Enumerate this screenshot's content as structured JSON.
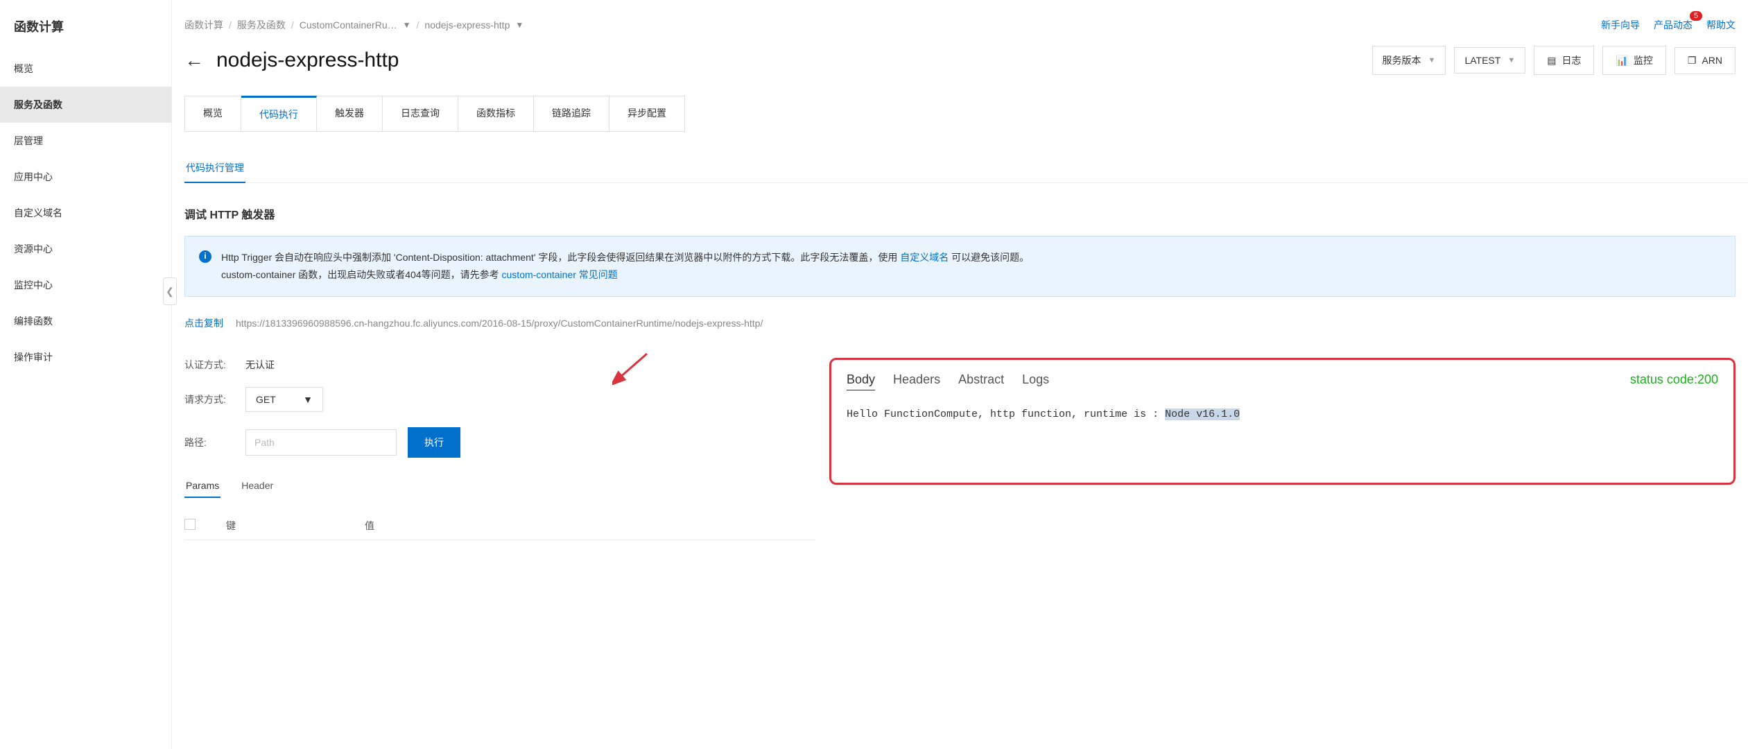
{
  "sidebar": {
    "title": "函数计算",
    "items": [
      "概览",
      "服务及函数",
      "层管理",
      "应用中心",
      "自定义域名",
      "资源中心",
      "监控中心",
      "编排函数",
      "操作审计"
    ],
    "active_index": 1
  },
  "top_links": {
    "guide": "新手向导",
    "news": "产品动态",
    "news_badge": "5",
    "help": "帮助文"
  },
  "breadcrumb": {
    "a": "函数计算",
    "b": "服务及函数",
    "c": "CustomContainerRu…",
    "d": "nodejs-express-http"
  },
  "page_title": "nodejs-express-http",
  "header_actions": {
    "version_label": "服务版本",
    "latest_label": "LATEST",
    "log_label": "日志",
    "monitor_label": "监控",
    "arn_label": "ARN"
  },
  "tabs": [
    "概览",
    "代码执行",
    "触发器",
    "日志查询",
    "函数指标",
    "链路追踪",
    "异步配置"
  ],
  "active_tab_index": 1,
  "subtab": "代码执行管理",
  "section_title": "调试 HTTP 触发器",
  "info": {
    "line1_a": "Http Trigger 会自动在响应头中强制添加 'Content-Disposition: attachment' 字段，此字段会使得返回结果在浏览器中以附件的方式下载。此字段无法覆盖，使用 ",
    "link1": "自定义域名",
    "line1_b": " 可以避免该问题。",
    "line2_a": "custom-container 函数，出现启动失败或者404等问题，请先参考 ",
    "link2": "custom-container 常见问题"
  },
  "url": {
    "copy": "点击复制",
    "value": "https://1813396960988596.cn-hangzhou.fc.aliyuncs.com/2016-08-15/proxy/CustomContainerRuntime/nodejs-express-http/"
  },
  "form": {
    "auth_label": "认证方式:",
    "auth_value": "无认证",
    "method_label": "请求方式:",
    "method_value": "GET",
    "path_label": "路径:",
    "path_placeholder": "Path",
    "exec_btn": "执行"
  },
  "mini_tabs": {
    "params": "Params",
    "header": "Header"
  },
  "table": {
    "key": "键",
    "val": "值"
  },
  "result": {
    "tabs": {
      "body": "Body",
      "headers": "Headers",
      "abstract": "Abstract",
      "logs": "Logs"
    },
    "status_label": "status code:",
    "status_code": "200",
    "body_text": "Hello FunctionCompute, http function, runtime is : ",
    "body_hl": "Node v16.1.0"
  }
}
